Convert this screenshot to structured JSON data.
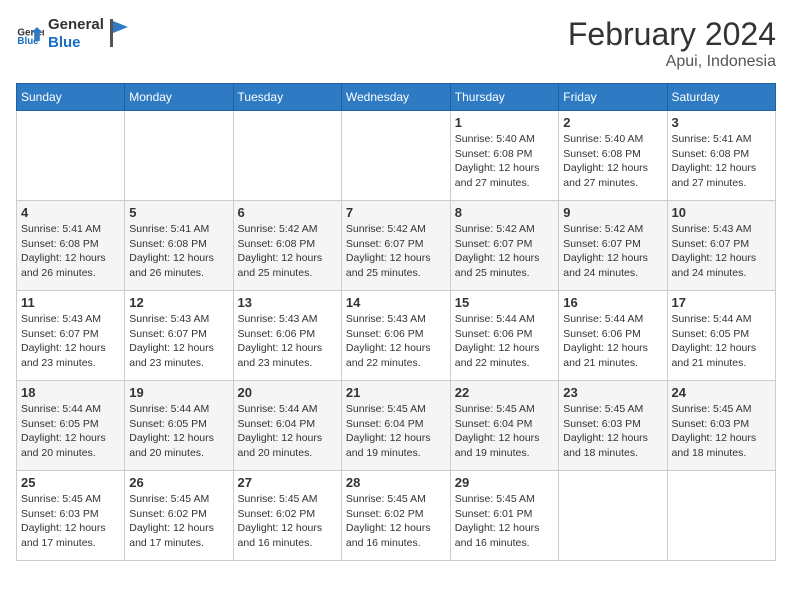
{
  "header": {
    "logo_general": "General",
    "logo_blue": "Blue",
    "month_year": "February 2024",
    "location": "Apui, Indonesia"
  },
  "columns": [
    "Sunday",
    "Monday",
    "Tuesday",
    "Wednesday",
    "Thursday",
    "Friday",
    "Saturday"
  ],
  "weeks": [
    [
      {
        "day": "",
        "info": ""
      },
      {
        "day": "",
        "info": ""
      },
      {
        "day": "",
        "info": ""
      },
      {
        "day": "",
        "info": ""
      },
      {
        "day": "1",
        "info": "Sunrise: 5:40 AM\nSunset: 6:08 PM\nDaylight: 12 hours\nand 27 minutes."
      },
      {
        "day": "2",
        "info": "Sunrise: 5:40 AM\nSunset: 6:08 PM\nDaylight: 12 hours\nand 27 minutes."
      },
      {
        "day": "3",
        "info": "Sunrise: 5:41 AM\nSunset: 6:08 PM\nDaylight: 12 hours\nand 27 minutes."
      }
    ],
    [
      {
        "day": "4",
        "info": "Sunrise: 5:41 AM\nSunset: 6:08 PM\nDaylight: 12 hours\nand 26 minutes."
      },
      {
        "day": "5",
        "info": "Sunrise: 5:41 AM\nSunset: 6:08 PM\nDaylight: 12 hours\nand 26 minutes."
      },
      {
        "day": "6",
        "info": "Sunrise: 5:42 AM\nSunset: 6:08 PM\nDaylight: 12 hours\nand 25 minutes."
      },
      {
        "day": "7",
        "info": "Sunrise: 5:42 AM\nSunset: 6:07 PM\nDaylight: 12 hours\nand 25 minutes."
      },
      {
        "day": "8",
        "info": "Sunrise: 5:42 AM\nSunset: 6:07 PM\nDaylight: 12 hours\nand 25 minutes."
      },
      {
        "day": "9",
        "info": "Sunrise: 5:42 AM\nSunset: 6:07 PM\nDaylight: 12 hours\nand 24 minutes."
      },
      {
        "day": "10",
        "info": "Sunrise: 5:43 AM\nSunset: 6:07 PM\nDaylight: 12 hours\nand 24 minutes."
      }
    ],
    [
      {
        "day": "11",
        "info": "Sunrise: 5:43 AM\nSunset: 6:07 PM\nDaylight: 12 hours\nand 23 minutes."
      },
      {
        "day": "12",
        "info": "Sunrise: 5:43 AM\nSunset: 6:07 PM\nDaylight: 12 hours\nand 23 minutes."
      },
      {
        "day": "13",
        "info": "Sunrise: 5:43 AM\nSunset: 6:06 PM\nDaylight: 12 hours\nand 23 minutes."
      },
      {
        "day": "14",
        "info": "Sunrise: 5:43 AM\nSunset: 6:06 PM\nDaylight: 12 hours\nand 22 minutes."
      },
      {
        "day": "15",
        "info": "Sunrise: 5:44 AM\nSunset: 6:06 PM\nDaylight: 12 hours\nand 22 minutes."
      },
      {
        "day": "16",
        "info": "Sunrise: 5:44 AM\nSunset: 6:06 PM\nDaylight: 12 hours\nand 21 minutes."
      },
      {
        "day": "17",
        "info": "Sunrise: 5:44 AM\nSunset: 6:05 PM\nDaylight: 12 hours\nand 21 minutes."
      }
    ],
    [
      {
        "day": "18",
        "info": "Sunrise: 5:44 AM\nSunset: 6:05 PM\nDaylight: 12 hours\nand 20 minutes."
      },
      {
        "day": "19",
        "info": "Sunrise: 5:44 AM\nSunset: 6:05 PM\nDaylight: 12 hours\nand 20 minutes."
      },
      {
        "day": "20",
        "info": "Sunrise: 5:44 AM\nSunset: 6:04 PM\nDaylight: 12 hours\nand 20 minutes."
      },
      {
        "day": "21",
        "info": "Sunrise: 5:45 AM\nSunset: 6:04 PM\nDaylight: 12 hours\nand 19 minutes."
      },
      {
        "day": "22",
        "info": "Sunrise: 5:45 AM\nSunset: 6:04 PM\nDaylight: 12 hours\nand 19 minutes."
      },
      {
        "day": "23",
        "info": "Sunrise: 5:45 AM\nSunset: 6:03 PM\nDaylight: 12 hours\nand 18 minutes."
      },
      {
        "day": "24",
        "info": "Sunrise: 5:45 AM\nSunset: 6:03 PM\nDaylight: 12 hours\nand 18 minutes."
      }
    ],
    [
      {
        "day": "25",
        "info": "Sunrise: 5:45 AM\nSunset: 6:03 PM\nDaylight: 12 hours\nand 17 minutes."
      },
      {
        "day": "26",
        "info": "Sunrise: 5:45 AM\nSunset: 6:02 PM\nDaylight: 12 hours\nand 17 minutes."
      },
      {
        "day": "27",
        "info": "Sunrise: 5:45 AM\nSunset: 6:02 PM\nDaylight: 12 hours\nand 16 minutes."
      },
      {
        "day": "28",
        "info": "Sunrise: 5:45 AM\nSunset: 6:02 PM\nDaylight: 12 hours\nand 16 minutes."
      },
      {
        "day": "29",
        "info": "Sunrise: 5:45 AM\nSunset: 6:01 PM\nDaylight: 12 hours\nand 16 minutes."
      },
      {
        "day": "",
        "info": ""
      },
      {
        "day": "",
        "info": ""
      }
    ]
  ]
}
